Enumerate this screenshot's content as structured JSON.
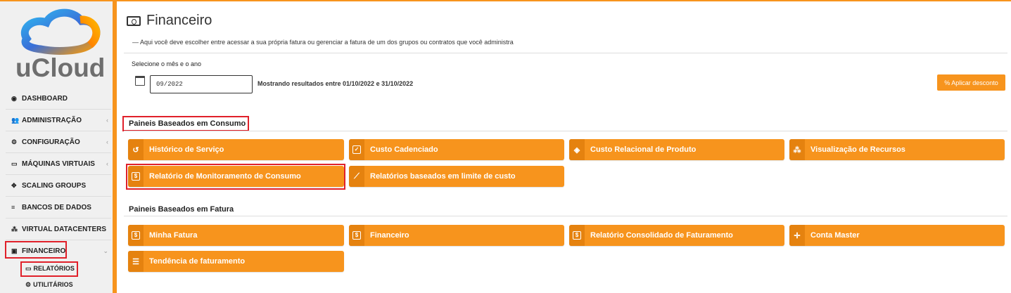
{
  "brand": {
    "name": "uCloud"
  },
  "sidebar": {
    "items": [
      {
        "label": "DASHBOARD",
        "icon": "dashboard-icon"
      },
      {
        "label": "ADMINISTRAÇÃO",
        "icon": "users-icon"
      },
      {
        "label": "CONFIGURAÇÃO",
        "icon": "gear-icon"
      },
      {
        "label": "MÁQUINAS VIRTUAIS",
        "icon": "monitor-icon"
      },
      {
        "label": "SCALING GROUPS",
        "icon": "arrows-icon"
      },
      {
        "label": "BANCOS DE DADOS",
        "icon": "database-icon"
      },
      {
        "label": "VIRTUAL DATACENTERS",
        "icon": "cubes-icon"
      },
      {
        "label": "FINANCEIRO",
        "icon": "money-icon"
      }
    ],
    "subitems": [
      {
        "label": "RELATÓRIOS",
        "icon": "monitor-icon"
      },
      {
        "label": "UTILITÁRIOS",
        "icon": "gears-icon"
      }
    ]
  },
  "page": {
    "title": "Financeiro",
    "description": "— Aqui você deve escolher entre acessar a sua própria fatura ou gerenciar a fatura de um dos grupos ou contratos que você administra"
  },
  "filter": {
    "label": "Selecione o mês e o ano",
    "date_value": "09/2022",
    "showing_text": "Mostrando resultados entre 01/10/2022 e 31/10/2022",
    "discount_button": "% Aplicar desconto"
  },
  "sections": {
    "consumo": {
      "title": "Paineis Baseados em Consumo",
      "tiles": [
        {
          "label": "Histórico de Serviço",
          "icon": "history-icon"
        },
        {
          "label": "Custo Cadenciado",
          "icon": "check-square-icon"
        },
        {
          "label": "Custo Relacional de Produto",
          "icon": "cube-icon"
        },
        {
          "label": "Visualização de Recursos",
          "icon": "cubes-icon"
        },
        {
          "label": "Relatório de Monitoramento de Consumo",
          "icon": "dollar-doc-icon"
        },
        {
          "label": "Relatórios baseados em limite de custo",
          "icon": "line-chart-icon"
        }
      ]
    },
    "fatura": {
      "title": "Paineis Baseados em Fatura",
      "tiles": [
        {
          "label": "Minha Fatura",
          "icon": "dollar-doc-icon"
        },
        {
          "label": "Financeiro",
          "icon": "dollar-doc-icon"
        },
        {
          "label": "Relatório Consolidado de Faturamento",
          "icon": "dollar-doc-icon"
        },
        {
          "label": "Conta Master",
          "icon": "crosshair-icon"
        },
        {
          "label": "Tendência de faturamento",
          "icon": "list-icon"
        }
      ]
    }
  },
  "colors": {
    "accent": "#f7941d",
    "highlight": "#e0202a"
  }
}
